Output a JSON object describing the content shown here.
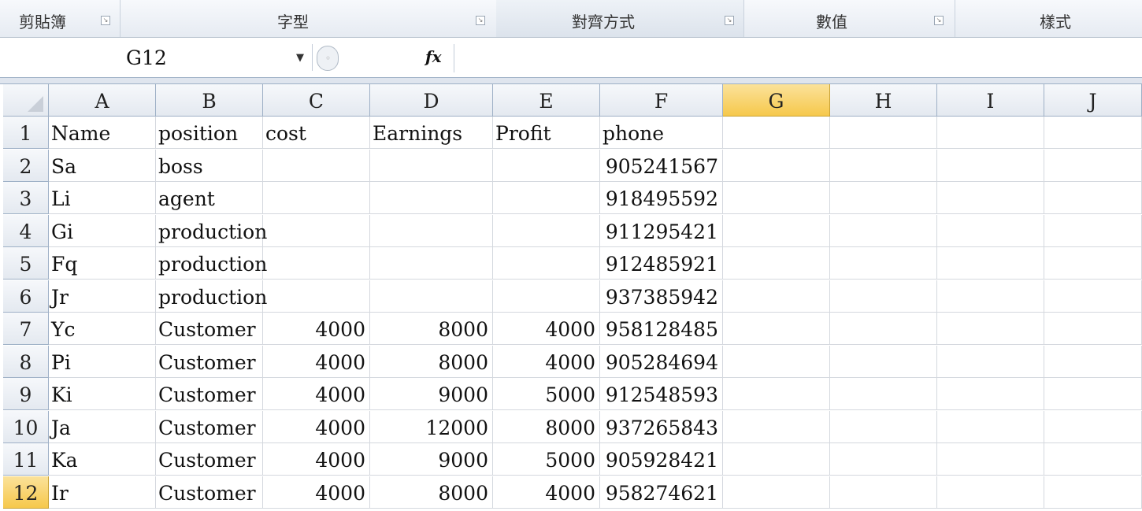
{
  "ribbon": {
    "groups": [
      {
        "label": "剪貼簿"
      },
      {
        "label": "字型"
      },
      {
        "label": "對齊方式"
      },
      {
        "label": "數值"
      },
      {
        "label": "樣式"
      }
    ]
  },
  "formula_bar": {
    "name_box": "G12",
    "fx_label": "fx",
    "formula": ""
  },
  "sheet": {
    "columns": [
      "A",
      "B",
      "C",
      "D",
      "E",
      "F",
      "G",
      "H",
      "I",
      "J"
    ],
    "selected_column": "G",
    "selected_row": "12",
    "rows": [
      {
        "n": "1",
        "cells": [
          "Name",
          "position",
          "cost",
          "Earnings",
          "Profit",
          "phone",
          "",
          "",
          "",
          ""
        ]
      },
      {
        "n": "2",
        "cells": [
          "Sa",
          "boss",
          "",
          "",
          "",
          "905241567",
          "",
          "",
          "",
          ""
        ]
      },
      {
        "n": "3",
        "cells": [
          "Li",
          "agent",
          "",
          "",
          "",
          "918495592",
          "",
          "",
          "",
          ""
        ]
      },
      {
        "n": "4",
        "cells": [
          "Gi",
          "production",
          "",
          "",
          "",
          "911295421",
          "",
          "",
          "",
          ""
        ]
      },
      {
        "n": "5",
        "cells": [
          "Fq",
          "production",
          "",
          "",
          "",
          "912485921",
          "",
          "",
          "",
          ""
        ]
      },
      {
        "n": "6",
        "cells": [
          "Jr",
          "production",
          "",
          "",
          "",
          "937385942",
          "",
          "",
          "",
          ""
        ]
      },
      {
        "n": "7",
        "cells": [
          "Yc",
          "Customer",
          "4000",
          "8000",
          "4000",
          "958128485",
          "",
          "",
          "",
          ""
        ]
      },
      {
        "n": "8",
        "cells": [
          "Pi",
          "Customer",
          "4000",
          "8000",
          "4000",
          "905284694",
          "",
          "",
          "",
          ""
        ]
      },
      {
        "n": "9",
        "cells": [
          "Ki",
          "Customer",
          "4000",
          "9000",
          "5000",
          "912548593",
          "",
          "",
          "",
          ""
        ]
      },
      {
        "n": "10",
        "cells": [
          "Ja",
          "Customer",
          "4000",
          "12000",
          "8000",
          "937265843",
          "",
          "",
          "",
          ""
        ]
      },
      {
        "n": "11",
        "cells": [
          "Ka",
          "Customer",
          "4000",
          "9000",
          "5000",
          "905928421",
          "",
          "",
          "",
          ""
        ]
      },
      {
        "n": "12",
        "cells": [
          "Ir",
          "Customer",
          "4000",
          "8000",
          "4000",
          "958274621",
          "",
          "",
          "",
          ""
        ]
      }
    ]
  },
  "colors": {
    "selected_header": "#f6c84c",
    "gridline": "#d4d8de",
    "header_bg": "#e4e9f0"
  }
}
